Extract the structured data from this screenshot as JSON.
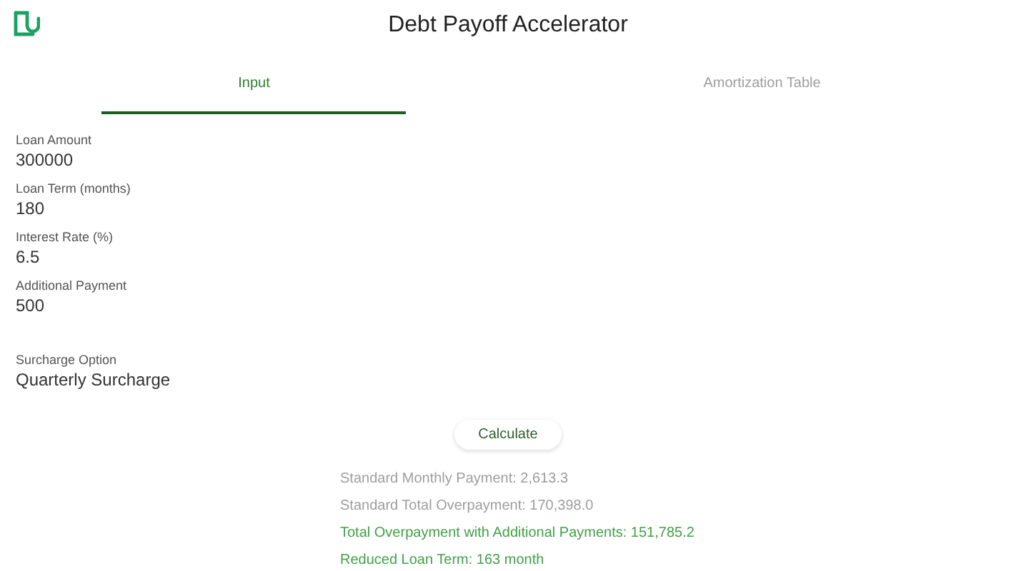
{
  "window": {
    "title": "Debt Payoff Accelerator"
  },
  "tabs": [
    {
      "label": "Input",
      "selected": true
    },
    {
      "label": "Amortization Table",
      "selected": false
    }
  ],
  "fields": [
    {
      "label": "Loan Amount",
      "value": "300000"
    },
    {
      "label": "Loan Term (months)",
      "value": "180"
    },
    {
      "label": "Interest Rate (%)",
      "value": "6.5"
    },
    {
      "label": "Additional Payment",
      "value": "500"
    }
  ],
  "surcharge": {
    "label": "Surcharge Option",
    "value": "Quarterly Surcharge"
  },
  "button": "Calculate",
  "results": [
    {
      "kind": "standard",
      "text": "Standard Monthly Payment: 2,613.3"
    },
    {
      "kind": "standard",
      "text": "Standard Total Overpayment: 170,398.0"
    },
    {
      "kind": "accelerated",
      "text": "Total Overpayment with Additional Payments: 151,785.2"
    },
    {
      "kind": "accelerated",
      "text": "Reduced Loan Term: 163 month"
    }
  ]
}
